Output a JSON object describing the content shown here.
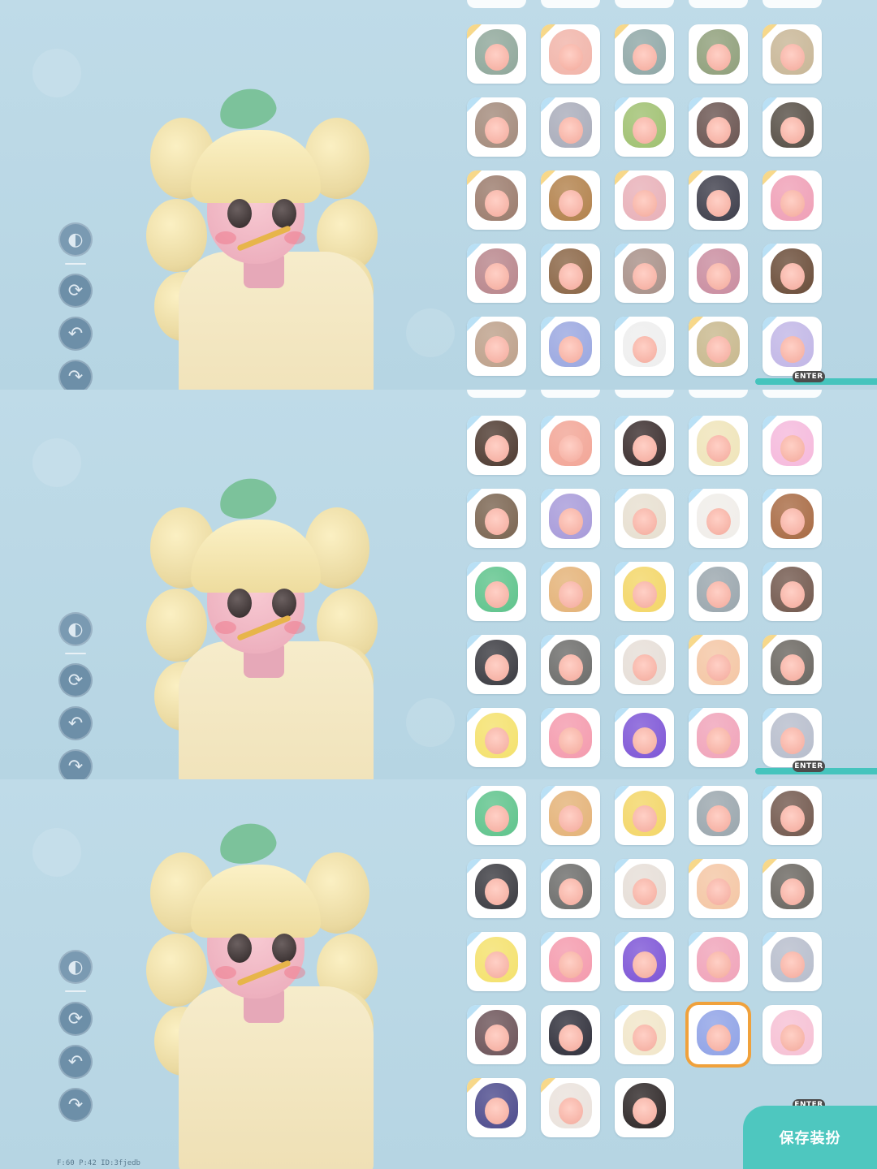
{
  "toolbar": {
    "icons": [
      "hide-icon",
      "rotate-icon",
      "undo-icon",
      "redo-icon"
    ]
  },
  "enter_label": "ENTER",
  "save_label": "保存装扮",
  "status_text": "F:60  P:42  ID:3fjedb",
  "panels": [
    {
      "rows": [
        [
          [
            "#8fa79a",
            "gold"
          ],
          [
            "#f1b4a9",
            "gold"
          ],
          [
            "#8fa7a6",
            "gold"
          ],
          [
            "#8f9f7a",
            "none"
          ],
          [
            "#c8b696",
            "gold"
          ]
        ],
        [
          [
            "#a38a7b",
            "rb"
          ],
          [
            "#a9acba",
            "rb"
          ],
          [
            "#9fc070",
            "rb"
          ],
          [
            "#6a5450",
            "rb"
          ],
          [
            "#564e45",
            "rb"
          ]
        ],
        [
          [
            "#9b7b6c",
            "gold"
          ],
          [
            "#b2814b",
            "gold"
          ],
          [
            "#e8b0b8",
            "gold"
          ],
          [
            "#3d3d4a",
            "gold"
          ],
          [
            "#ef9fb6",
            "gold"
          ]
        ],
        [
          [
            "#b8858b",
            "rb"
          ],
          [
            "#8a6545",
            "rb"
          ],
          [
            "#a89088",
            "rb"
          ],
          [
            "#c98c9f",
            "rb"
          ],
          [
            "#6a4c38",
            "rb"
          ]
        ],
        [
          [
            "#bda08a",
            "rb"
          ],
          [
            "#9aa7e0",
            "rb"
          ],
          [
            "#eeeeee",
            "rb"
          ],
          [
            "#c8b88d",
            "gold"
          ],
          [
            "#c1b6e6",
            "rb"
          ]
        ]
      ]
    },
    {
      "rows": [
        [
          [
            "#4e3a30",
            "rb"
          ],
          [
            "#f2a596",
            "rb"
          ],
          [
            "#3a2d2d",
            "rb"
          ],
          [
            "#efe4b9",
            "rb"
          ],
          [
            "#f5b9dc",
            "rb"
          ]
        ],
        [
          [
            "#7a6450",
            "rb"
          ],
          [
            "#a79ad9",
            "rb"
          ],
          [
            "#e7dfd0",
            "rb"
          ],
          [
            "#f0ede9",
            "rb"
          ],
          [
            "#a86a43",
            "rb"
          ]
        ],
        [
          [
            "#5ec38b",
            "rb"
          ],
          [
            "#e4b277",
            "rb"
          ],
          [
            "#f3d667",
            "rb"
          ],
          [
            "#9aa6ad",
            "rb"
          ],
          [
            "#72584d",
            "rb"
          ]
        ],
        [
          [
            "#3a3a40",
            "rb"
          ],
          [
            "#6c6c6a",
            "rb"
          ],
          [
            "#e6ded7",
            "rb"
          ],
          [
            "#f4c6a4",
            "gold"
          ],
          [
            "#6a6660",
            "gold"
          ]
        ],
        [
          [
            "#f4e16c",
            "rb"
          ],
          [
            "#f49aad",
            "rb"
          ],
          [
            "#7d55d6",
            "rb"
          ],
          [
            "#f0a3b9",
            "rb"
          ],
          [
            "#b7bdcc",
            "rb"
          ]
        ]
      ]
    },
    {
      "rows": [
        [
          [
            "#5ec38b",
            "rb"
          ],
          [
            "#e4b277",
            "rb"
          ],
          [
            "#f3d667",
            "rb"
          ],
          [
            "#9aa6ad",
            "rb"
          ],
          [
            "#72584d",
            "rb"
          ]
        ],
        [
          [
            "#3a3a40",
            "rb"
          ],
          [
            "#6c6c6a",
            "rb"
          ],
          [
            "#e6ded7",
            "rb"
          ],
          [
            "#f4c6a4",
            "gold"
          ],
          [
            "#6a6660",
            "gold"
          ]
        ],
        [
          [
            "#f4e16c",
            "rb"
          ],
          [
            "#f49aad",
            "rb"
          ],
          [
            "#7d55d6",
            "rb"
          ],
          [
            "#f0a3b9",
            "rb"
          ],
          [
            "#b7bdcc",
            "rb"
          ]
        ],
        [
          [
            "#6c5358",
            "rb"
          ],
          [
            "#2f2f3a",
            "none"
          ],
          [
            "#f1e6c9",
            "rb"
          ],
          [
            "#8fa2e6",
            "sel"
          ],
          [
            "#f6c0d4",
            "none"
          ]
        ],
        [
          [
            "#4c4a8c",
            "gold"
          ],
          [
            "#eae2dc",
            "gold"
          ],
          [
            "#2d2626",
            "none"
          ]
        ]
      ]
    }
  ]
}
